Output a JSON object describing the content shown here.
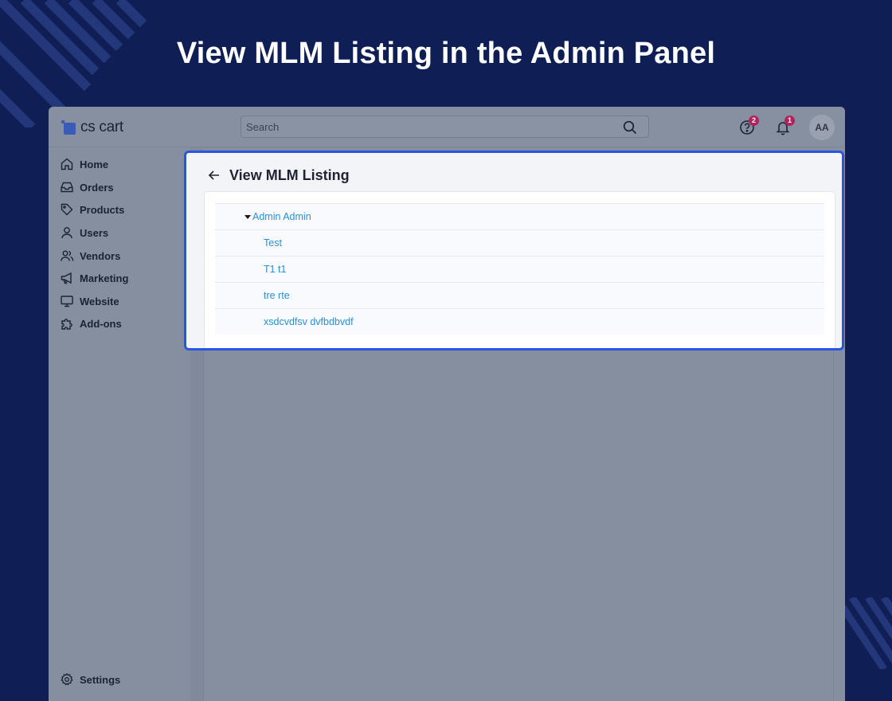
{
  "headline": "View MLM Listing in the Admin Panel",
  "colors": {
    "background": "#0f1f55",
    "accent": "#2a55e0",
    "link": "#2a8fd6",
    "badge": "#b0245c"
  },
  "app": {
    "logo_text": "cs cart",
    "search": {
      "placeholder": "Search",
      "icon": "search-icon"
    },
    "help": {
      "icon": "help-circle-icon",
      "badge": "2"
    },
    "notifications": {
      "icon": "bell-icon",
      "badge": "1"
    },
    "avatar": "AA"
  },
  "sidebar": {
    "items": [
      {
        "label": "Home",
        "icon": "home-icon"
      },
      {
        "label": "Orders",
        "icon": "inbox-icon"
      },
      {
        "label": "Products",
        "icon": "tag-icon"
      },
      {
        "label": "Users",
        "icon": "user-icon"
      },
      {
        "label": "Vendors",
        "icon": "users-icon"
      },
      {
        "label": "Marketing",
        "icon": "megaphone-icon"
      },
      {
        "label": "Website",
        "icon": "monitor-icon"
      },
      {
        "label": "Add-ons",
        "icon": "puzzle-icon"
      }
    ],
    "settings": {
      "label": "Settings",
      "icon": "gear-icon"
    }
  },
  "listing": {
    "title": "View MLM Listing",
    "back_icon": "arrow-left-icon",
    "root": {
      "label": "Admin Admin",
      "icon": "caret-down-icon"
    },
    "children": [
      {
        "label": "Test"
      },
      {
        "label": "T1 t1"
      },
      {
        "label": "tre rte"
      },
      {
        "label": "xsdcvdfsv dvfbdbvdf"
      }
    ]
  }
}
